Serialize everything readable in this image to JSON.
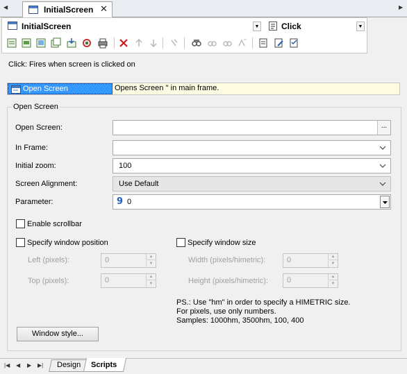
{
  "tab": {
    "title": "InitialScreen",
    "close": "✕"
  },
  "editor": {
    "object": "InitialScreen",
    "event": "Click"
  },
  "description": "Click: Fires when screen is clicked on",
  "action": {
    "name": "Open Screen",
    "description": "Opens Screen '' in main frame."
  },
  "group": {
    "title": "Open Screen",
    "open_screen": {
      "label": "Open Screen:",
      "value": "",
      "browse": "..."
    },
    "in_frame": {
      "label": "In Frame:",
      "value": ""
    },
    "initial_zoom": {
      "label": "Initial zoom:",
      "value": "100"
    },
    "alignment": {
      "label": "Screen Alignment:",
      "value": "Use Default"
    },
    "parameter": {
      "label": "Parameter:",
      "value": "0"
    },
    "enable_scrollbar": {
      "label": "Enable scrollbar",
      "checked": false
    },
    "position": {
      "label": "Specify window position",
      "checked": false,
      "left": {
        "label": "Left (pixels):",
        "value": "0"
      },
      "top": {
        "label": "Top (pixels):",
        "value": "0"
      }
    },
    "size": {
      "label": "Specify window size",
      "checked": false,
      "width": {
        "label": "Width (pixels/himetric):",
        "value": "0"
      },
      "height": {
        "label": "Height (pixels/himetric):",
        "value": "0"
      }
    },
    "note": [
      "PS.: Use \"hm\" in order to specify a HIMETRIC size.",
      "For pixels, use only numbers.",
      "Samples: 1000hm, 3500hm, 100, 400"
    ],
    "window_style_button": "Window style..."
  },
  "bottom_tabs": [
    {
      "label": "Design"
    },
    {
      "label": "Scripts",
      "active": true
    }
  ]
}
